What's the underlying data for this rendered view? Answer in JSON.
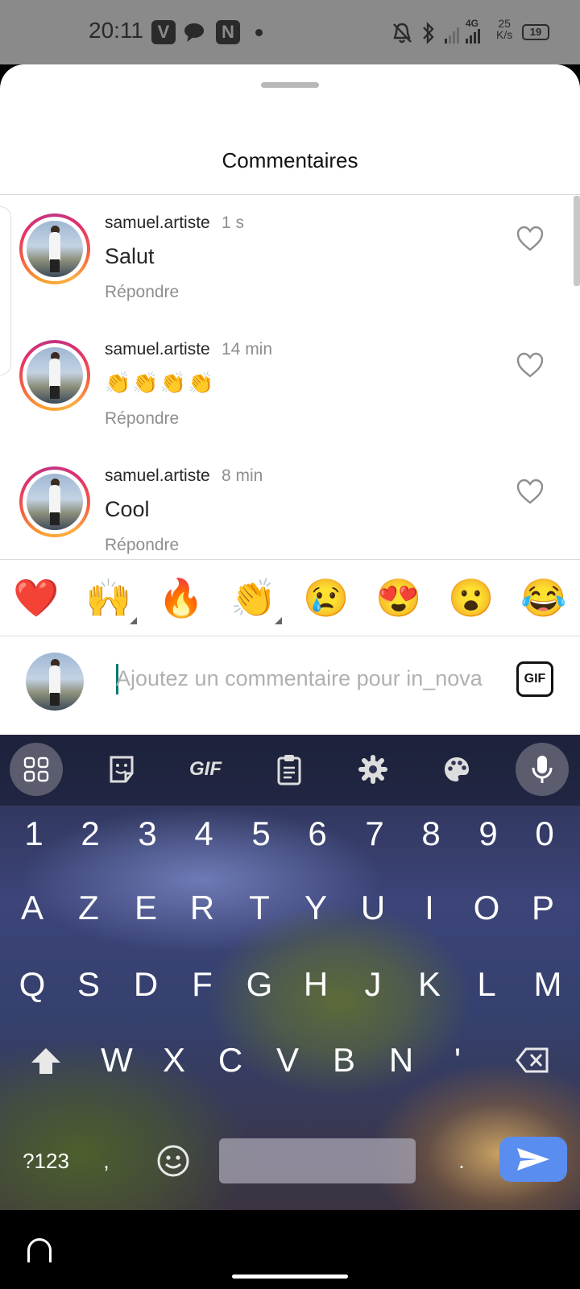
{
  "status_bar": {
    "time": "20:11",
    "app_icons": [
      "V",
      "chat-bubble",
      "N"
    ],
    "net_speed_value": "25",
    "net_speed_unit": "K/s",
    "network": "4G",
    "battery": "19"
  },
  "sheet": {
    "title": "Commentaires"
  },
  "comments": [
    {
      "username": "samuel.artiste",
      "time": "1 s",
      "text": "Salut",
      "reply_label": "Répondre"
    },
    {
      "username": "samuel.artiste",
      "time": "14 min",
      "text": "👏👏👏👏",
      "reply_label": "Répondre"
    },
    {
      "username": "samuel.artiste",
      "time": "8 min",
      "text": "Cool",
      "reply_label": "Répondre"
    }
  ],
  "reactions": [
    "❤️",
    "🙌",
    "🔥",
    "👏",
    "😢",
    "😍",
    "😮",
    "😂"
  ],
  "composer": {
    "placeholder": "Ajoutez un commentaire pour in_nova",
    "gif_label": "GIF"
  },
  "keyboard": {
    "toolbar_gif_label": "GIF",
    "number_row": [
      "1",
      "2",
      "3",
      "4",
      "5",
      "6",
      "7",
      "8",
      "9",
      "0"
    ],
    "row1": [
      "A",
      "Z",
      "E",
      "R",
      "T",
      "Y",
      "U",
      "I",
      "O",
      "P"
    ],
    "row2": [
      "Q",
      "S",
      "D",
      "F",
      "G",
      "H",
      "J",
      "K",
      "L",
      "M"
    ],
    "row3": [
      "W",
      "X",
      "C",
      "V",
      "B",
      "N",
      "'"
    ],
    "symbols_label": "?123",
    "comma": ",",
    "period": "."
  },
  "colors": {
    "accent_send": "#5a8df0",
    "heart_red": "#e0245e",
    "ring_orange": "#f9a12e",
    "ring_magenta": "#c13584"
  }
}
